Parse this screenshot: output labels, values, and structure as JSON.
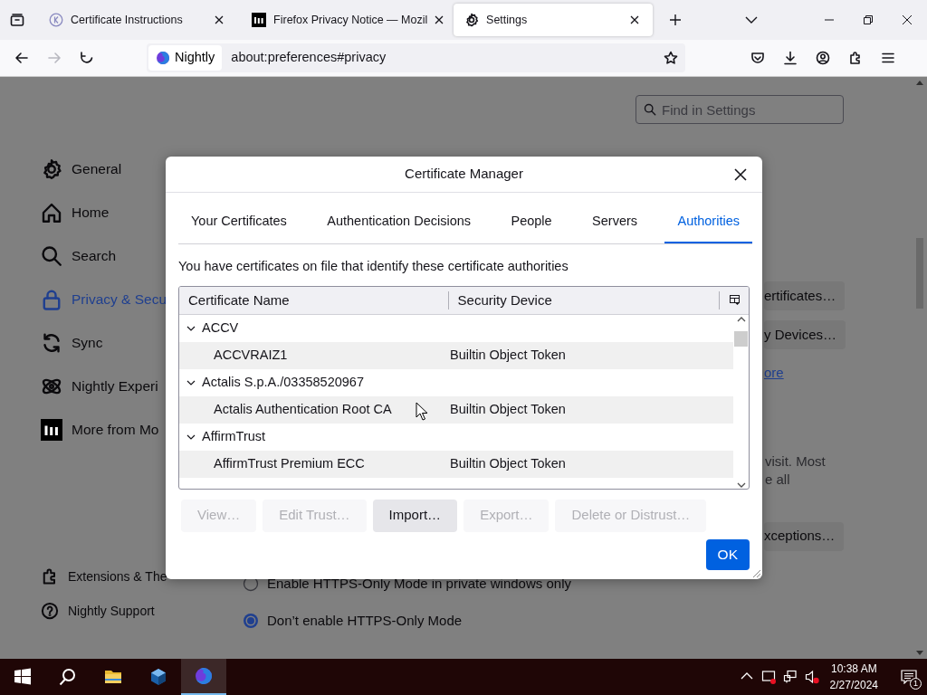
{
  "browser_tabs": [
    {
      "title": "Certificate Instructions",
      "kind": "circle",
      "selected": false
    },
    {
      "title": "Firefox Privacy Notice — Mozil",
      "kind": "mozilla",
      "selected": false
    },
    {
      "title": "Settings",
      "kind": "gear",
      "selected": true
    }
  ],
  "address_bar": {
    "identity": "Nightly",
    "url": "about:preferences#privacy"
  },
  "settings": {
    "search": {
      "placeholder": "Find in Settings"
    },
    "sidebar": [
      {
        "label": "General",
        "kind": "gear",
        "selected": false
      },
      {
        "label": "Home",
        "kind": "home",
        "selected": false
      },
      {
        "label": "Search",
        "kind": "search",
        "selected": false
      },
      {
        "label": "Privacy & Secu",
        "kind": "lock",
        "selected": true
      },
      {
        "label": "Sync",
        "kind": "sync",
        "selected": false
      },
      {
        "label": "Nightly Experi",
        "kind": "atom",
        "selected": false
      },
      {
        "label": "More from Mo",
        "kind": "mozilla",
        "selected": false
      }
    ],
    "footer_links": [
      {
        "label": "Extensions & The",
        "kind": "puzzle"
      },
      {
        "label": "Nightly Support",
        "kind": "help"
      }
    ],
    "side_buttons": [
      "ertificates…",
      "y Devices…"
    ],
    "link": "ore",
    "text_lines": [
      "visit. Most",
      "e all"
    ],
    "exceptions_button": "xceptions…",
    "radios": [
      {
        "label": "Enable HTTPS-Only Mode in private windows only",
        "selected": false
      },
      {
        "label": "Don’t enable HTTPS-Only Mode",
        "selected": true
      }
    ]
  },
  "dialog": {
    "title": "Certificate Manager",
    "tabs": [
      {
        "label": "Your Certificates",
        "selected": false
      },
      {
        "label": "Authentication Decisions",
        "selected": false
      },
      {
        "label": "People",
        "selected": false
      },
      {
        "label": "Servers",
        "selected": false
      },
      {
        "label": "Authorities",
        "selected": true
      }
    ],
    "description": "You have certificates on file that identify these certificate authorities",
    "columns": [
      "Certificate Name",
      "Security Device"
    ],
    "tree": [
      {
        "name": "ACCV",
        "expanded": true,
        "children": [
          {
            "name": "ACCVRAIZ1",
            "device": "Builtin Object Token"
          }
        ]
      },
      {
        "name": "Actalis S.p.A./03358520967",
        "expanded": true,
        "children": [
          {
            "name": "Actalis Authentication Root CA",
            "device": "Builtin Object Token"
          }
        ]
      },
      {
        "name": "AffirmTrust",
        "expanded": true,
        "children": [
          {
            "name": "AffirmTrust Premium ECC",
            "device": "Builtin Object Token"
          }
        ]
      }
    ],
    "buttons": [
      {
        "label": "View…",
        "disabled": true
      },
      {
        "label": "Edit Trust…",
        "disabled": true
      },
      {
        "label": "Import…",
        "disabled": false
      },
      {
        "label": "Export…",
        "disabled": true
      },
      {
        "label": "Delete or Distrust…",
        "disabled": true
      }
    ],
    "ok": "OK"
  },
  "taskbar": {
    "time": "10:38 AM",
    "date": "2/27/2024",
    "notifications": "1"
  }
}
